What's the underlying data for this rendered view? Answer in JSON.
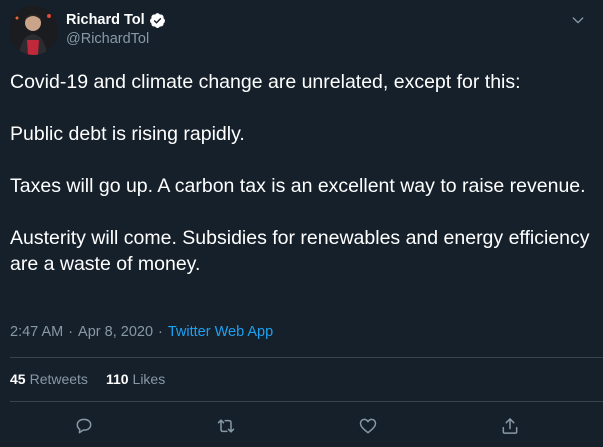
{
  "user": {
    "display_name": "Richard Tol",
    "handle": "@RichardTol"
  },
  "tweet": {
    "paragraphs": [
      "Covid-19 and climate change are unrelated, except for this:",
      "Public debt is rising rapidly.",
      "Taxes will go up. A carbon tax is an excellent way to raise revenue.",
      "Austerity will come. Subsidies for renewables and energy efficiency are a waste of money."
    ],
    "time": "2:47 AM",
    "date": "Apr 8, 2020",
    "source": "Twitter Web App",
    "separator": "·"
  },
  "stats": {
    "retweets_count": "45",
    "retweets_label": "Retweets",
    "likes_count": "110",
    "likes_label": "Likes"
  },
  "actions": [
    "reply-icon",
    "retweet-icon",
    "like-icon",
    "share-icon"
  ],
  "colors": {
    "background": "#15202b",
    "text": "#ffffff",
    "secondary": "#8899a6",
    "accent": "#1da1f2",
    "divider": "#38444d"
  }
}
